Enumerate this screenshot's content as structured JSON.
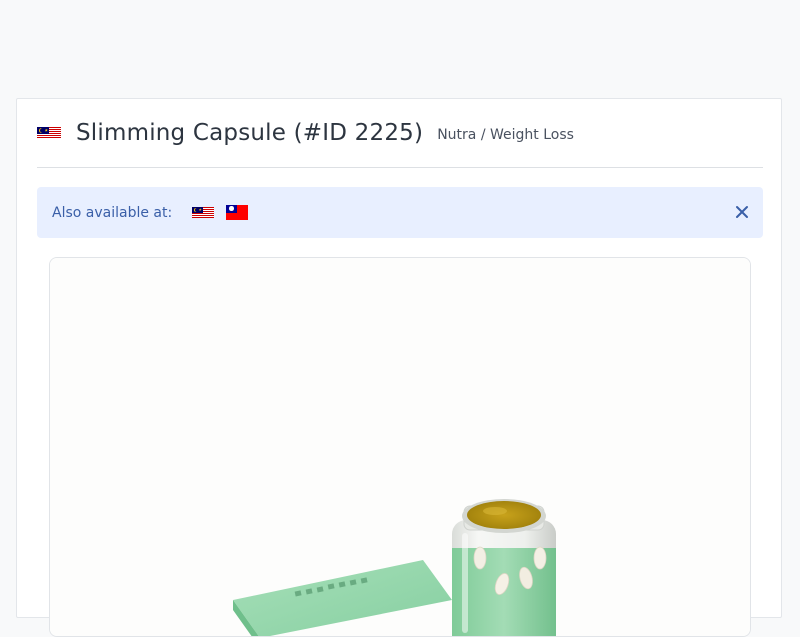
{
  "offer": {
    "title": "Slimming Capsule (#ID 2225)",
    "category": "Nutra / Weight Loss",
    "country_flag": "malaysia-flag"
  },
  "availability": {
    "label": "Also available at:",
    "countries": [
      "malaysia-flag",
      "taiwan-flag"
    ],
    "close_icon": "close-icon"
  },
  "product_image": {
    "alt": "slimming capsule product photo"
  },
  "colors": {
    "page_background": "#f8f9fa",
    "alert_background": "#e8efff",
    "alert_text": "#3a5fa8",
    "title_text": "#2d3540",
    "product_green": "#8fd3a8",
    "bottle_lid": "#b8940f"
  }
}
